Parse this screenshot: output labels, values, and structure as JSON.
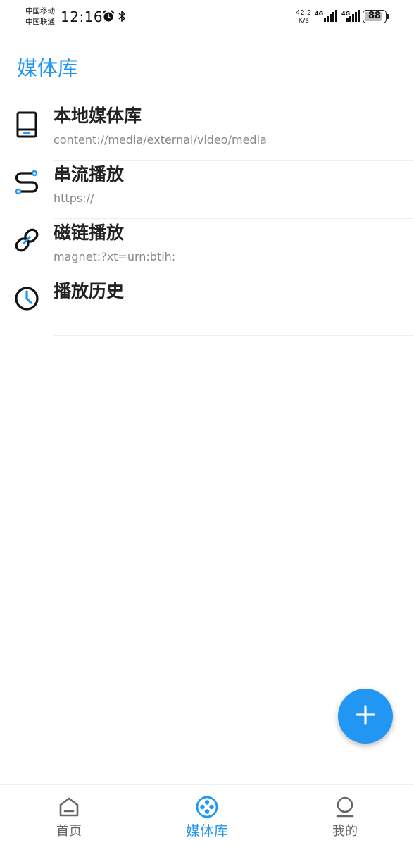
{
  "status_bar": {
    "carrier_1": "中国移动",
    "carrier_2": "中国联通",
    "time": "12:16",
    "net_speed_value": "42.2",
    "net_speed_unit": "K/s",
    "net_type_1": "4G",
    "net_type_2": "4G",
    "battery": "88",
    "battery_level": 0.88,
    "icons": [
      "alarm-icon",
      "bluetooth-icon",
      "signal-icon",
      "battery-icon"
    ]
  },
  "header": {
    "title": "媒体库"
  },
  "list": {
    "items": [
      {
        "title": "本地媒体库",
        "subtitle": "content://media/external/video/media",
        "icon": "tablet-icon"
      },
      {
        "title": "串流播放",
        "subtitle": "https://",
        "icon": "stream-icon"
      },
      {
        "title": "磁链播放",
        "subtitle": "magnet:?xt=urn:btih:",
        "icon": "link-icon"
      },
      {
        "title": "播放历史",
        "subtitle": "",
        "icon": "clock-icon"
      }
    ]
  },
  "fab": {
    "icon": "plus-icon"
  },
  "bottom_nav": {
    "items": [
      {
        "label": "首页",
        "icon": "home-icon",
        "active": false
      },
      {
        "label": "媒体库",
        "icon": "film-reel-icon",
        "active": true
      },
      {
        "label": "我的",
        "icon": "profile-icon",
        "active": false
      }
    ]
  },
  "colors": {
    "accent": "#2196f3",
    "text_primary": "#222222",
    "text_secondary": "#888888"
  }
}
